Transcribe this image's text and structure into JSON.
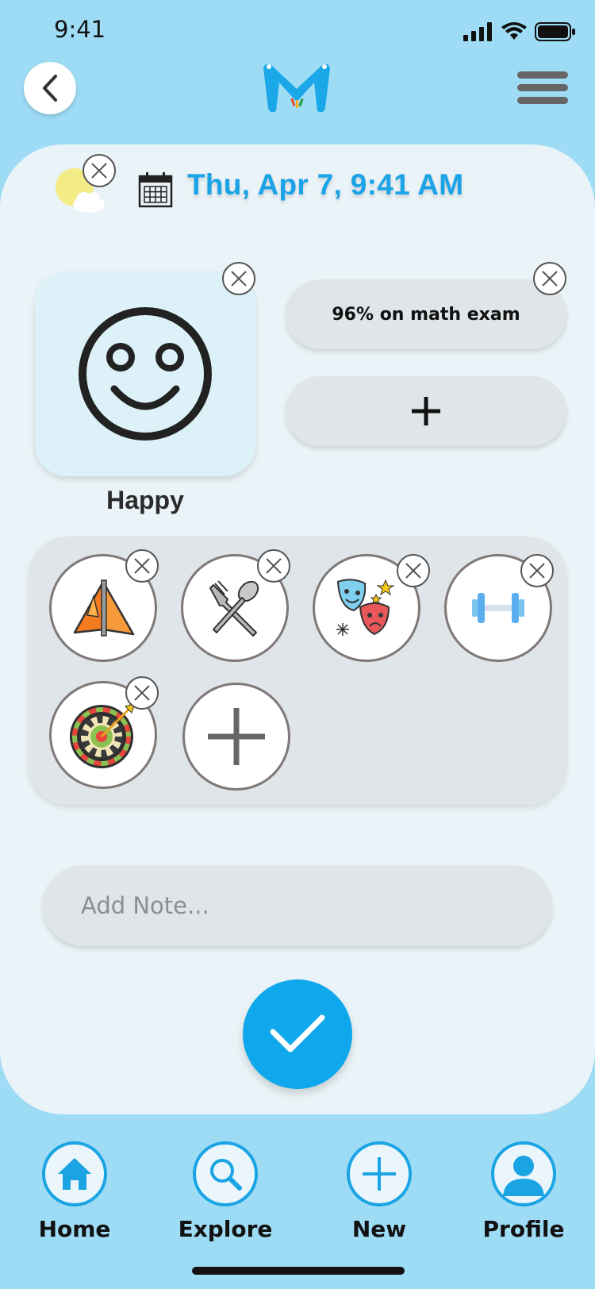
{
  "status_bar": {
    "time": "9:41"
  },
  "header": {
    "back_icon": "chevron-left-icon",
    "logo": "app-logo",
    "menu_icon": "hamburger-menu-icon"
  },
  "entry": {
    "weather_icon": "partly-sunny-icon",
    "calendar_icon": "calendar-icon",
    "datetime": "Thu, Apr 7, 9:41 AM"
  },
  "mood": {
    "label": "Happy",
    "icon": "smiley-face-icon"
  },
  "highlights": {
    "items": [
      {
        "label": "96% on math exam"
      }
    ],
    "add_icon": "plus-icon"
  },
  "activities": {
    "items": [
      {
        "icon": "tent-icon"
      },
      {
        "icon": "fork-spoon-icon"
      },
      {
        "icon": "theater-masks-icon"
      },
      {
        "icon": "dumbbell-icon"
      },
      {
        "icon": "dartboard-icon"
      }
    ],
    "add_icon": "plus-icon"
  },
  "note": {
    "placeholder": "Add Note..."
  },
  "confirm_icon": "checkmark-icon",
  "nav": {
    "items": [
      {
        "label": "Home",
        "icon": "home-icon"
      },
      {
        "label": "Explore",
        "icon": "search-icon"
      },
      {
        "label": "New",
        "icon": "plus-icon"
      },
      {
        "label": "Profile",
        "icon": "user-icon"
      }
    ]
  },
  "colors": {
    "background": "#9edcf5",
    "card": "#eaf3f7",
    "accent": "#0fa8ec",
    "date_text": "#1aa3e6",
    "mood_box": "#ddf2f8",
    "chip": "#dfe5e8"
  }
}
